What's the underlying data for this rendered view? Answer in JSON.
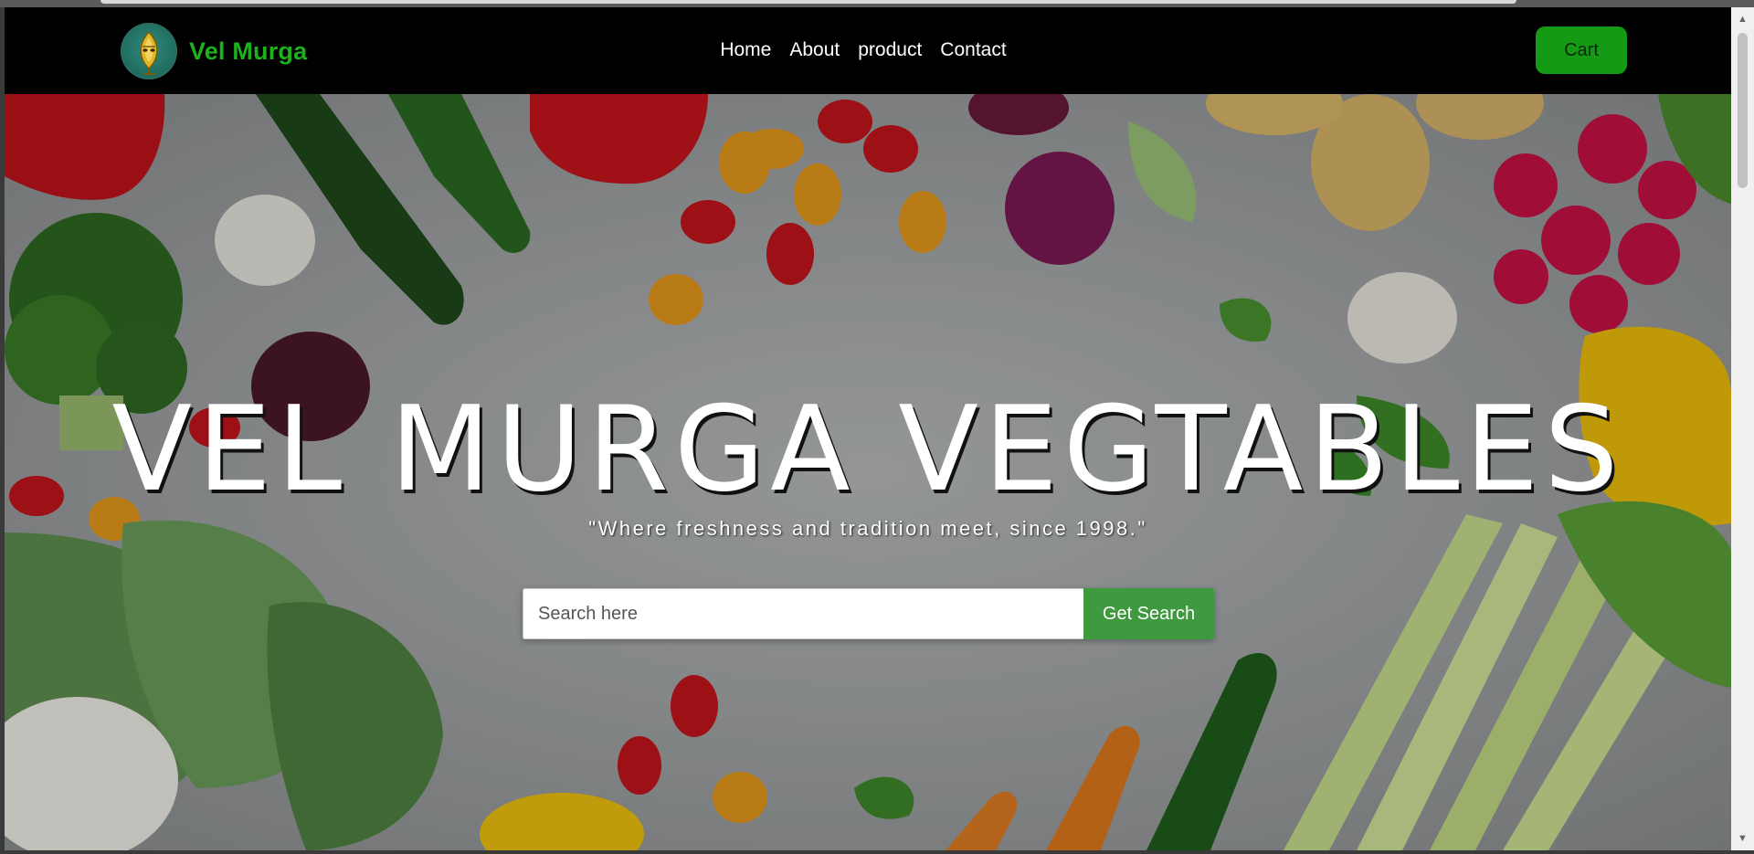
{
  "brand": {
    "name": "Vel Murga",
    "logo_icon": "lotus-emblem-icon"
  },
  "nav": {
    "links": [
      {
        "label": "Home"
      },
      {
        "label": "About"
      },
      {
        "label": "product"
      },
      {
        "label": "Contact"
      }
    ],
    "cart_label": "Cart"
  },
  "hero": {
    "title": "VEL MURGA VEGTABLES",
    "subtitle": "\"Where freshness and tradition meet, since 1998.\"",
    "search": {
      "placeholder": "Search here",
      "value": "",
      "button_label": "Get Search"
    }
  },
  "colors": {
    "brand_green": "#1db11d",
    "cart_button": "#159a15",
    "search_button": "#3f9a3f",
    "navbar": "#000000"
  }
}
